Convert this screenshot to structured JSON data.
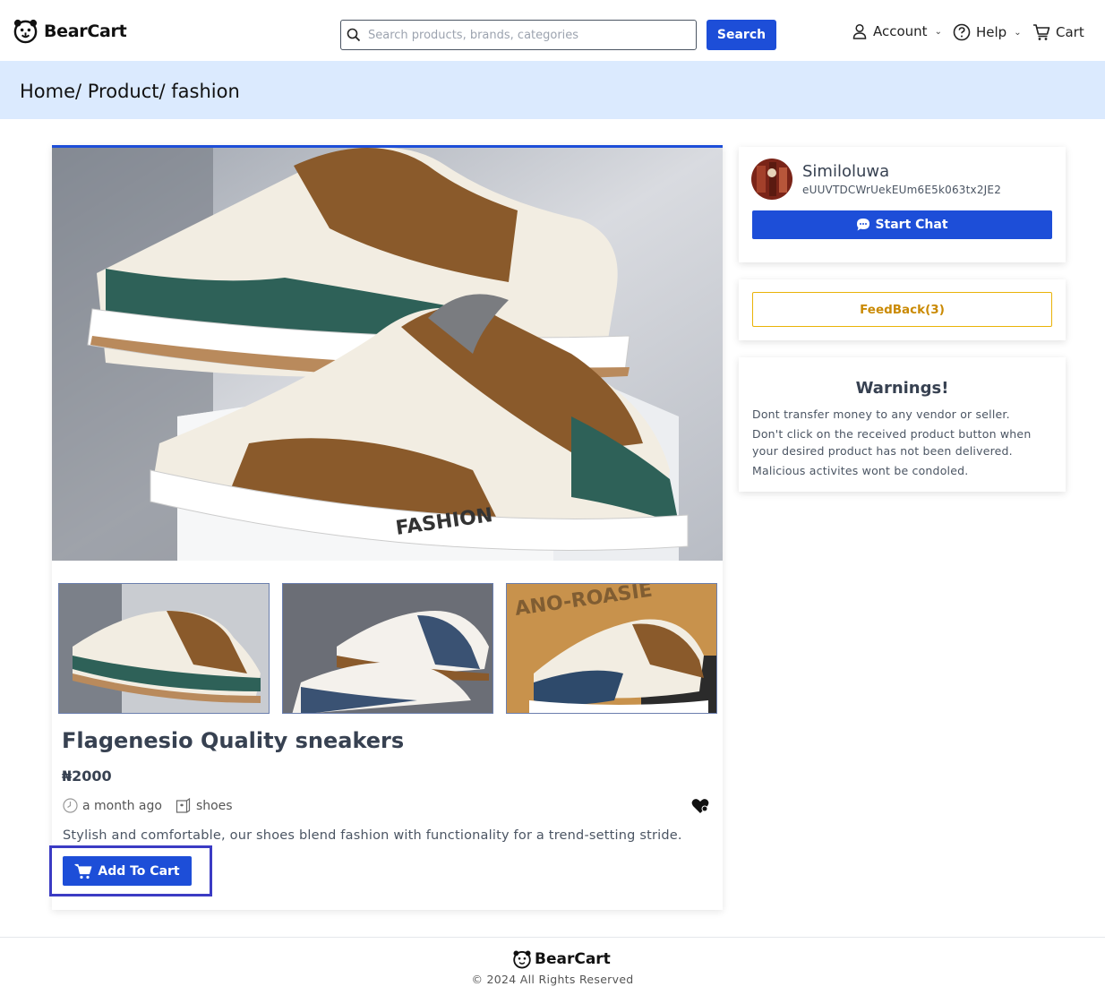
{
  "brand": {
    "name": "BearCart"
  },
  "search": {
    "placeholder": "Search products, brands, categories",
    "button_label": "Search"
  },
  "nav": {
    "account": "Account",
    "help": "Help",
    "cart": "Cart"
  },
  "breadcrumb": "Home/ Product/ fashion",
  "product": {
    "title": "Flagenesio Quality sneakers",
    "price": "₦2000",
    "posted": "a month ago",
    "category": "shoes",
    "description": "Stylish and comfortable, our shoes blend fashion with functionality for a trend-setting stride.",
    "add_to_cart_label": "Add To Cart",
    "image_text": "FASHION"
  },
  "seller": {
    "name": "Similoluwa",
    "id": "eUUVTDCWrUekEUm6E5k063tx2JE2",
    "chat_label": "Start Chat"
  },
  "feedback": {
    "label": "FeedBack(3)"
  },
  "warnings": {
    "title": "Warnings!",
    "lines": [
      "Dont transfer money to any vendor or seller.",
      "Don't click on the received product button when your desired product has not been delivered.",
      "Malicious activites wont be condoled."
    ]
  },
  "footer": {
    "brand": "BearCart",
    "copyright": "© 2024 All Rights Reserved"
  },
  "colors": {
    "primary": "#1d4ed8",
    "breadcrumb_bg": "#dbeafe",
    "feedback": "#ca8a04",
    "focus_outline": "#3b3bc4"
  }
}
